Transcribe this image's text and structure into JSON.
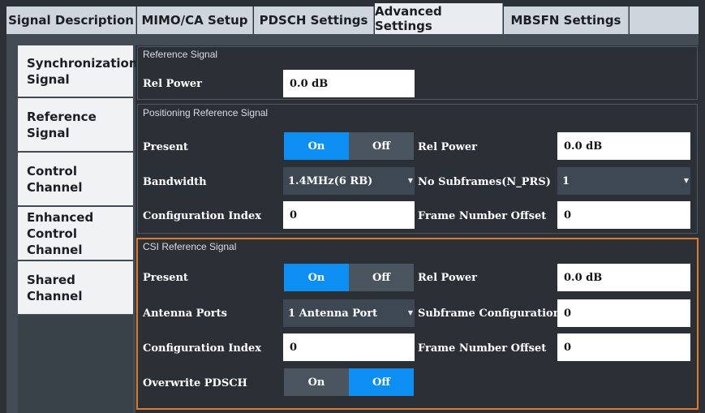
{
  "tabs": [
    "Signal Description",
    "MIMO/CA Setup",
    "PDSCH Settings",
    "Advanced Settings",
    "MBSFN Settings"
  ],
  "sidebar": {
    "items": [
      {
        "label": "Synchronization Signal"
      },
      {
        "label": "Reference Signal"
      },
      {
        "label": "Control Channel"
      },
      {
        "label": "Enhanced Control Channel"
      },
      {
        "label": "Shared Channel"
      }
    ]
  },
  "ref_signal": {
    "title": "Reference Signal",
    "rel_power_label": "Rel Power",
    "rel_power_value": "0.0 dB"
  },
  "prs": {
    "title": "Positioning Reference Signal",
    "present_label": "Present",
    "on": "On",
    "off": "Off",
    "present_state": "On",
    "rel_power_label": "Rel Power",
    "rel_power_value": "0.0 dB",
    "bandwidth_label": "Bandwidth",
    "bandwidth_value": "1.4MHz(6 RB)",
    "no_subframes_label": "No Subframes(N_PRS)",
    "no_subframes_value": "1",
    "config_index_label": "Configuration Index",
    "config_index_value": "0",
    "frame_offset_label": "Frame Number Offset",
    "frame_offset_value": "0"
  },
  "csi": {
    "title": "CSI Reference Signal",
    "present_label": "Present",
    "on": "On",
    "off": "Off",
    "present_state": "On",
    "rel_power_label": "Rel Power",
    "rel_power_value": "0.0 dB",
    "antenna_ports_label": "Antenna Ports",
    "antenna_ports_value": "1 Antenna Port",
    "subframe_config_label": "Subframe Configuration",
    "subframe_config_value": "0",
    "config_index_label": "Configuration Index",
    "config_index_value": "0",
    "frame_offset_label": "Frame Number Offset",
    "frame_offset_value": "0",
    "overwrite_label": "Overwrite PDSCH",
    "overwrite_state": "Off"
  },
  "colors": {
    "accent": "#0d8ef2",
    "highlight": "#e07a24",
    "background": "#2a3036"
  }
}
